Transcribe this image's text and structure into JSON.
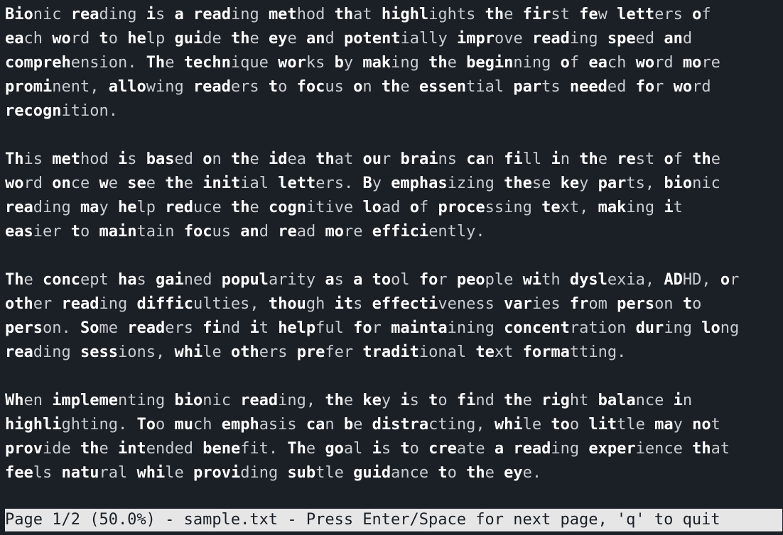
{
  "document": {
    "paragraphs": [
      [
        "**Bio**nic **rea**ding **i**s **a** **read**ing **met**hod **th**at **highl**ights **th**e **fir**st **fe**w **lett**ers **o**f",
        "**ea**ch **wo**rd **t**o **he**lp **gui**de **th**e **ey**e **an**d **potent**ially **impr**ove **read**ing **spe**ed **an**d",
        "**compreh**ension. **Th**e **techn**ique **wor**ks **b**y **mak**ing **th**e **begin**ning **o**f **ea**ch **wo**rd **mo**re",
        "**promi**nent, **allo**wing **read**ers **t**o **foc**us **o**n **th**e **essen**tial **par**ts **need**ed **fo**r **wo**rd",
        "**recogn**ition."
      ],
      [
        "**Th**is **met**hod **i**s **bas**ed **o**n **th**e **id**ea **th**at **ou**r **brai**ns **ca**n **fi**ll **i**n **th**e **re**st **o**f **th**e",
        "**wo**rd **on**ce **w**e **se**e **th**e **init**ial **lett**ers. **B**y **emphas**izing **the**se **ke**y **par**ts, **bio**nic",
        "**rea**ding **ma**y **he**lp **red**uce **th**e **cogn**itive **lo**ad **o**f **proce**ssing **te**xt, **mak**ing **i**t",
        "**eas**ier **t**o **main**tain **foc**us **an**d **re**ad **mo**re **effici**ently."
      ],
      [
        "**Th**e **conc**ept **ha**s **gai**ned **popul**arity **a**s **a** **to**ol **fo**r **peo**ple **wi**th **dysl**exia, **AD**HD, **o**r",
        "**oth**er **read**ing **diffic**ulties, **thou**gh **it**s **effecti**veness **var**ies **fr**om **pers**on **t**o",
        "**pers**on. **So**me **read**ers **fi**nd **i**t **help**ful **fo**r **mainta**ining **concent**ration **dur**ing **lo**ng",
        "**rea**ding **sess**ions, **whi**le **oth**ers **pre**fer **tradit**ional **te**xt **forma**tting."
      ],
      [
        "**Wh**en **impleme**nting **bio**nic **read**ing, **th**e **ke**y **i**s **t**o **fi**nd **th**e **rig**ht **bala**nce **i**n",
        "**highli**ghting. **To**o **mu**ch **emph**asis **ca**n **b**e **distra**cting, **whi**le **to**o **lit**tle **ma**y **no**t",
        "**prov**ide **th**e **int**ended **bene**fit. **Th**e **go**al **i**s **t**o **cre**ate **a** **read**ing **exper**ience **th**at",
        "**fee**ls **natu**ral **whi**le **provi**ding **sub**tle **guid**ance **t**o **th**e **ey**e."
      ]
    ]
  },
  "status_bar": {
    "text": "Page 1/2 (50.0%) - sample.txt - Press Enter/Space for next page, 'q' to quit",
    "current_page": 1,
    "total_pages": 2,
    "percent": 50.0,
    "filename": "sample.txt"
  },
  "colors": {
    "background": "#1b2027",
    "text_normal": "#c9ccd1",
    "text_bold": "#ffffff",
    "status_bg": "#e6e6e6",
    "status_fg": "#1b2027"
  }
}
